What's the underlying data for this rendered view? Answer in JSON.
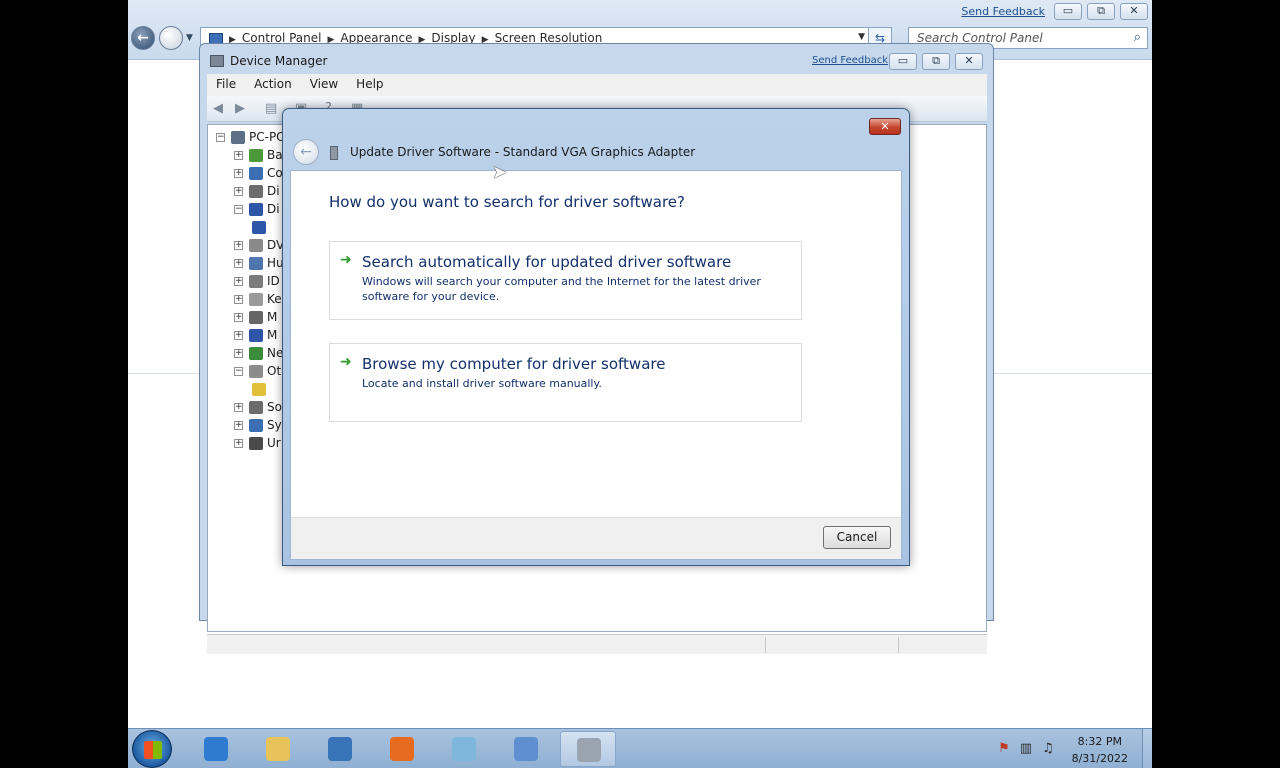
{
  "control_panel": {
    "send_feedback": "Send Feedback",
    "breadcrumbs": [
      "Control Panel",
      "Appearance",
      "Display",
      "Screen Resolution"
    ],
    "search_placeholder": "Search Control Panel",
    "window_buttons": {
      "minimize": "▭",
      "restore": "⧉",
      "close": "✕"
    }
  },
  "device_manager": {
    "title": "Device Manager",
    "send_feedback": "Send Feedback",
    "menu": [
      "File",
      "Action",
      "View",
      "Help"
    ],
    "tree": [
      {
        "label": "PC-PC",
        "expander": "−",
        "icon_color": "#5b6f86"
      },
      {
        "label": "Ba",
        "expander": "+",
        "icon_color": "#4a9a3c"
      },
      {
        "label": "Co",
        "expander": "+",
        "icon_color": "#3b6fb4"
      },
      {
        "label": "Di",
        "expander": "+",
        "icon_color": "#6c6c6c"
      },
      {
        "label": "Di",
        "expander": "−",
        "icon_color": "#2d56a8"
      },
      {
        "label": "",
        "expander": "",
        "icon_color": "#2d56a8"
      },
      {
        "label": "DV",
        "expander": "+",
        "icon_color": "#8a8a8a"
      },
      {
        "label": "Hu",
        "expander": "+",
        "icon_color": "#4f76ad"
      },
      {
        "label": "ID",
        "expander": "+",
        "icon_color": "#7b7b7b"
      },
      {
        "label": "Ke",
        "expander": "+",
        "icon_color": "#9a9a9a"
      },
      {
        "label": "M",
        "expander": "+",
        "icon_color": "#666666"
      },
      {
        "label": "M",
        "expander": "+",
        "icon_color": "#2d56a8"
      },
      {
        "label": "Ne",
        "expander": "+",
        "icon_color": "#3b8c3b"
      },
      {
        "label": "Ot",
        "expander": "−",
        "icon_color": "#8c8c8c"
      },
      {
        "label": "",
        "expander": "",
        "icon_color": "#e3c03a"
      },
      {
        "label": "So",
        "expander": "+",
        "icon_color": "#6b6b6b"
      },
      {
        "label": "Sy",
        "expander": "+",
        "icon_color": "#3b6fb4"
      },
      {
        "label": "Ur",
        "expander": "+",
        "icon_color": "#4a4a4a"
      }
    ]
  },
  "dialog": {
    "header_title": "Update Driver Software - Standard VGA Graphics Adapter",
    "question": "How do you want to search for driver software?",
    "options": [
      {
        "title": "Search automatically for updated driver software",
        "description": "Windows will search your computer and the Internet for the latest driver software for your device."
      },
      {
        "title": "Browse my computer for driver software",
        "description": "Locate and install driver software manually."
      }
    ],
    "cancel_label": "Cancel",
    "close_glyph": "✕",
    "back_glyph": "←",
    "option_arrow": "➜"
  },
  "taskbar": {
    "apps": [
      {
        "name": "internet-explorer",
        "color": "#2f7bd1",
        "active": false
      },
      {
        "name": "windows-explorer",
        "color": "#e7c35a",
        "active": false
      },
      {
        "name": "media-player",
        "color": "#3a74b8",
        "active": false
      },
      {
        "name": "firefox",
        "color": "#e66b1e",
        "active": false
      },
      {
        "name": "app-5",
        "color": "#7fb6dc",
        "active": false
      },
      {
        "name": "app-6",
        "color": "#5f8fd0",
        "active": false
      },
      {
        "name": "device-manager",
        "color": "#9aa4b0",
        "active": true
      }
    ],
    "time": "8:32 PM",
    "date": "8/31/2022"
  },
  "colors": {
    "link": "#1c4f8e",
    "dialog_text": "#13306b",
    "option_arrow": "#2e9a2e",
    "close_red": "#c4452e"
  }
}
